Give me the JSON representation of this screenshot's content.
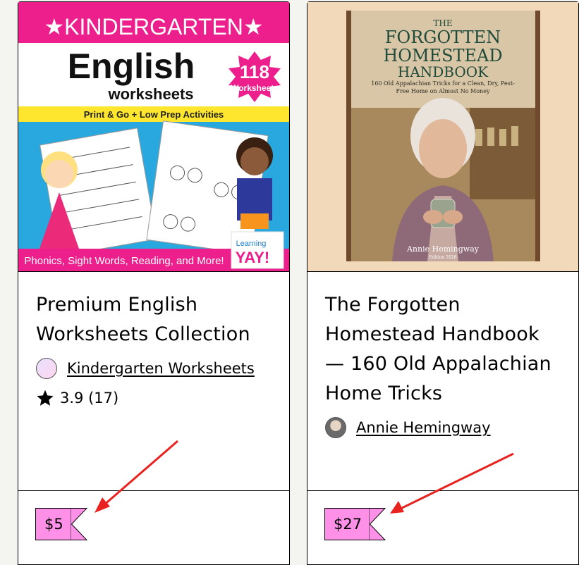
{
  "products": [
    {
      "title": "Premium English Worksheets Collection",
      "creator": "Kindergarten Worksheets",
      "rating": "3.9 (17)",
      "price": "$5",
      "cover": {
        "banner": "★KINDERGARTEN★",
        "heading": "English",
        "subheading": "worksheets",
        "badge_number": "118",
        "badge_label": "Worksheets",
        "strip": "Print & Go + Low Prep Activities",
        "footer": "Phonics, Sight Words, Reading, and More!",
        "logo_top": "Learning",
        "logo_bottom": "YAY!"
      }
    },
    {
      "title": "The Forgotten Homestead Handbook — 160 Old Appalachian Home Tricks",
      "creator": "Annie Hemingway",
      "price": "$27",
      "cover": {
        "the": "THE",
        "line1": "FORGOTTEN",
        "line2": "HOMESTEAD",
        "line3": "HANDBOOK",
        "subtitle": "160 Old Appalachian Tricks for a Clean, Dry, Pest-Free Home on Almost No Money",
        "author": "Annie Hemingway",
        "edition": "Edition 2026"
      }
    }
  ],
  "colors": {
    "price_tag": "#ff90e8",
    "arrow": "#e8231f"
  }
}
